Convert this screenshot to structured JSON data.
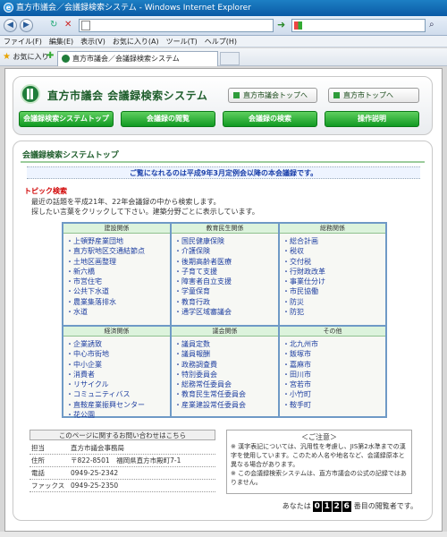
{
  "browser": {
    "window_title": "直方市議会／会議録検索システム - Windows Internet Explorer",
    "menu": [
      "ファイル(F)",
      "編集(E)",
      "表示(V)",
      "お気に入り(A)",
      "ツール(T)",
      "ヘルプ(H)"
    ],
    "favorites_label": "お気に入り",
    "tab_title": "直方市議会／会議録検索システム"
  },
  "header": {
    "site_title": "直方市議会 会議録検索システム",
    "top_links": [
      "直方市議会トップへ",
      "直方市トップへ"
    ],
    "nav": [
      "会議録検索システムトップ",
      "会議録の閲覧",
      "会議録の検索",
      "操作説明"
    ]
  },
  "panel": {
    "title": "会議録検索システムトップ",
    "notice": "ご覧になれるのは平成9年3月定例会以降の本会議録です。",
    "topic_heading": "トピック検索",
    "topic_lines": [
      "最近の話題を平成21年、22年会議録の中から検索します。",
      "探したい言葉をクリックして下さい。建築分野ごとに表示しています。"
    ]
  },
  "topics": [
    {
      "heading": "建設関係",
      "items": [
        "上頓野産業団地",
        "直方駅地区交通結節点",
        "土地区画整理",
        "新六橋",
        "市営住宅",
        "公共下水道",
        "農業集落排水",
        "水道"
      ]
    },
    {
      "heading": "教育民生関係",
      "items": [
        "国民健康保険",
        "介護保険",
        "後期高齢者医療",
        "子育て支援",
        "障害者自立支援",
        "学童保育",
        "教育行政",
        "通学区域審議会"
      ]
    },
    {
      "heading": "総務関係",
      "items": [
        "総合計画",
        "税収",
        "交付税",
        "行財政改革",
        "事業仕分け",
        "市民協働",
        "防災",
        "防犯"
      ]
    },
    {
      "heading": "経済関係",
      "items": [
        "企業誘致",
        "中心市街地",
        "中小企業",
        "消費者",
        "リサイクル",
        "コミュニティバス",
        "直鞍産業振興センター",
        "花公園"
      ]
    },
    {
      "heading": "議会関係",
      "items": [
        "議員定数",
        "議員報酬",
        "政務調査費",
        "特別委員会",
        "総務常任委員会",
        "教育民生常任委員会",
        "産業建設常任委員会"
      ]
    },
    {
      "heading": "その他",
      "items": [
        "北九州市",
        "飯塚市",
        "嘉麻市",
        "田川市",
        "宮若市",
        "小竹町",
        "鞍手町"
      ]
    }
  ],
  "contact": {
    "heading": "このページに関するお問い合わせはこちら",
    "rows": [
      {
        "label": "担当",
        "value": "直方市議会事務局"
      },
      {
        "label": "住所",
        "value": "〒822-8501　福岡県直方市殿町7-1"
      },
      {
        "label": "電話",
        "value": "0949-25-2342"
      },
      {
        "label": "ファックス",
        "value": "0949-25-2350"
      }
    ]
  },
  "caution": {
    "title": "＜ご注意＞",
    "lines": [
      "※ 漢字表記については、汎用性を考慮し、JIS第2水準までの漢字を使用しています。このため人名や地名など、会議録原本と異なる場合があります。",
      "※ この会議録検索システムは、直方市議会の公式の記録ではありません。"
    ]
  },
  "counter": {
    "prefix": "あなたは",
    "digits": [
      "0",
      "1",
      "2",
      "6"
    ],
    "suffix": "番目の閲覧者です。"
  }
}
